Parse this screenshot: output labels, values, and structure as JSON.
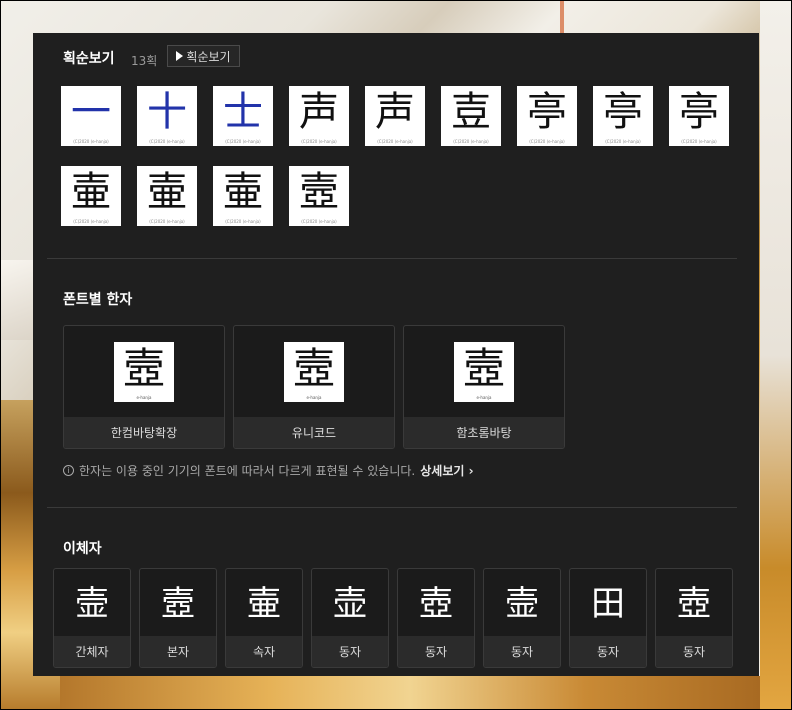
{
  "stroke_order": {
    "title": "획순보기",
    "count": "13획",
    "play_button": "획순보기",
    "frames": [
      {
        "glyph": "一",
        "watermark": "(C)2020 (e-hanja)"
      },
      {
        "glyph": "十",
        "watermark": "(C)2020 (e-hanja)"
      },
      {
        "glyph": "士",
        "watermark": "(C)2020 (e-hanja)"
      },
      {
        "glyph": "声",
        "watermark": "(C)2020 (e-hanja)"
      },
      {
        "glyph": "声",
        "watermark": "(C)2020 (e-hanja)"
      },
      {
        "glyph": "壴",
        "watermark": "(C)2020 (e-hanja)"
      },
      {
        "glyph": "亭",
        "watermark": "(C)2020 (e-hanja)"
      },
      {
        "glyph": "亭",
        "watermark": "(C)2020 (e-hanja)"
      },
      {
        "glyph": "亭",
        "watermark": "(C)2020 (e-hanja)"
      },
      {
        "glyph": "壷",
        "watermark": "(C)2020 (e-hanja)"
      },
      {
        "glyph": "壷",
        "watermark": "(C)2020 (e-hanja)"
      },
      {
        "glyph": "壷",
        "watermark": "(C)2020 (e-hanja)"
      },
      {
        "glyph": "壼",
        "watermark": "(C)2020 (e-hanja)"
      }
    ]
  },
  "font_hanja": {
    "title": "폰트별 한자",
    "cards": [
      {
        "glyph": "壼",
        "watermark": "e-hanja",
        "label": "한컴바탕확장"
      },
      {
        "glyph": "壼",
        "watermark": "e-hanja",
        "label": "유니코드"
      },
      {
        "glyph": "壼",
        "watermark": "e-hanja",
        "label": "함초롬바탕"
      }
    ],
    "note": "한자는 이용 중인 기기의 폰트에 따라서 다르게 표현될 수 있습니다.",
    "more_link": "상세보기 ›"
  },
  "variants": {
    "title": "이체자",
    "cards": [
      {
        "glyph": "壸",
        "label": "간체자"
      },
      {
        "glyph": "壼",
        "label": "본자"
      },
      {
        "glyph": "壷",
        "label": "속자"
      },
      {
        "glyph": "壶",
        "label": "동자"
      },
      {
        "glyph": "壺",
        "label": "동자"
      },
      {
        "glyph": "壸",
        "label": "동자"
      },
      {
        "glyph": "田",
        "label": "동자"
      },
      {
        "glyph": "壺",
        "label": "동자"
      }
    ]
  },
  "colors": {
    "panel_bg": "#1f1f1f",
    "stroke_highlight": "#2233aa",
    "divider": "#3a3a3a"
  }
}
